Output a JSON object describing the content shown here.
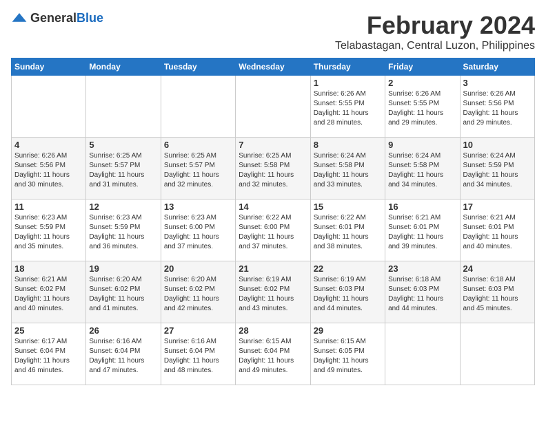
{
  "logo": {
    "text_general": "General",
    "text_blue": "Blue"
  },
  "title": {
    "month_year": "February 2024",
    "location": "Telabastagan, Central Luzon, Philippines"
  },
  "weekdays": [
    "Sunday",
    "Monday",
    "Tuesday",
    "Wednesday",
    "Thursday",
    "Friday",
    "Saturday"
  ],
  "weeks": [
    [
      {
        "day": "",
        "info": ""
      },
      {
        "day": "",
        "info": ""
      },
      {
        "day": "",
        "info": ""
      },
      {
        "day": "",
        "info": ""
      },
      {
        "day": "1",
        "info": "Sunrise: 6:26 AM\nSunset: 5:55 PM\nDaylight: 11 hours\nand 28 minutes."
      },
      {
        "day": "2",
        "info": "Sunrise: 6:26 AM\nSunset: 5:55 PM\nDaylight: 11 hours\nand 29 minutes."
      },
      {
        "day": "3",
        "info": "Sunrise: 6:26 AM\nSunset: 5:56 PM\nDaylight: 11 hours\nand 29 minutes."
      }
    ],
    [
      {
        "day": "4",
        "info": "Sunrise: 6:26 AM\nSunset: 5:56 PM\nDaylight: 11 hours\nand 30 minutes."
      },
      {
        "day": "5",
        "info": "Sunrise: 6:25 AM\nSunset: 5:57 PM\nDaylight: 11 hours\nand 31 minutes."
      },
      {
        "day": "6",
        "info": "Sunrise: 6:25 AM\nSunset: 5:57 PM\nDaylight: 11 hours\nand 32 minutes."
      },
      {
        "day": "7",
        "info": "Sunrise: 6:25 AM\nSunset: 5:58 PM\nDaylight: 11 hours\nand 32 minutes."
      },
      {
        "day": "8",
        "info": "Sunrise: 6:24 AM\nSunset: 5:58 PM\nDaylight: 11 hours\nand 33 minutes."
      },
      {
        "day": "9",
        "info": "Sunrise: 6:24 AM\nSunset: 5:58 PM\nDaylight: 11 hours\nand 34 minutes."
      },
      {
        "day": "10",
        "info": "Sunrise: 6:24 AM\nSunset: 5:59 PM\nDaylight: 11 hours\nand 34 minutes."
      }
    ],
    [
      {
        "day": "11",
        "info": "Sunrise: 6:23 AM\nSunset: 5:59 PM\nDaylight: 11 hours\nand 35 minutes."
      },
      {
        "day": "12",
        "info": "Sunrise: 6:23 AM\nSunset: 5:59 PM\nDaylight: 11 hours\nand 36 minutes."
      },
      {
        "day": "13",
        "info": "Sunrise: 6:23 AM\nSunset: 6:00 PM\nDaylight: 11 hours\nand 37 minutes."
      },
      {
        "day": "14",
        "info": "Sunrise: 6:22 AM\nSunset: 6:00 PM\nDaylight: 11 hours\nand 37 minutes."
      },
      {
        "day": "15",
        "info": "Sunrise: 6:22 AM\nSunset: 6:01 PM\nDaylight: 11 hours\nand 38 minutes."
      },
      {
        "day": "16",
        "info": "Sunrise: 6:21 AM\nSunset: 6:01 PM\nDaylight: 11 hours\nand 39 minutes."
      },
      {
        "day": "17",
        "info": "Sunrise: 6:21 AM\nSunset: 6:01 PM\nDaylight: 11 hours\nand 40 minutes."
      }
    ],
    [
      {
        "day": "18",
        "info": "Sunrise: 6:21 AM\nSunset: 6:02 PM\nDaylight: 11 hours\nand 40 minutes."
      },
      {
        "day": "19",
        "info": "Sunrise: 6:20 AM\nSunset: 6:02 PM\nDaylight: 11 hours\nand 41 minutes."
      },
      {
        "day": "20",
        "info": "Sunrise: 6:20 AM\nSunset: 6:02 PM\nDaylight: 11 hours\nand 42 minutes."
      },
      {
        "day": "21",
        "info": "Sunrise: 6:19 AM\nSunset: 6:02 PM\nDaylight: 11 hours\nand 43 minutes."
      },
      {
        "day": "22",
        "info": "Sunrise: 6:19 AM\nSunset: 6:03 PM\nDaylight: 11 hours\nand 44 minutes."
      },
      {
        "day": "23",
        "info": "Sunrise: 6:18 AM\nSunset: 6:03 PM\nDaylight: 11 hours\nand 44 minutes."
      },
      {
        "day": "24",
        "info": "Sunrise: 6:18 AM\nSunset: 6:03 PM\nDaylight: 11 hours\nand 45 minutes."
      }
    ],
    [
      {
        "day": "25",
        "info": "Sunrise: 6:17 AM\nSunset: 6:04 PM\nDaylight: 11 hours\nand 46 minutes."
      },
      {
        "day": "26",
        "info": "Sunrise: 6:16 AM\nSunset: 6:04 PM\nDaylight: 11 hours\nand 47 minutes."
      },
      {
        "day": "27",
        "info": "Sunrise: 6:16 AM\nSunset: 6:04 PM\nDaylight: 11 hours\nand 48 minutes."
      },
      {
        "day": "28",
        "info": "Sunrise: 6:15 AM\nSunset: 6:04 PM\nDaylight: 11 hours\nand 49 minutes."
      },
      {
        "day": "29",
        "info": "Sunrise: 6:15 AM\nSunset: 6:05 PM\nDaylight: 11 hours\nand 49 minutes."
      },
      {
        "day": "",
        "info": ""
      },
      {
        "day": "",
        "info": ""
      }
    ]
  ]
}
